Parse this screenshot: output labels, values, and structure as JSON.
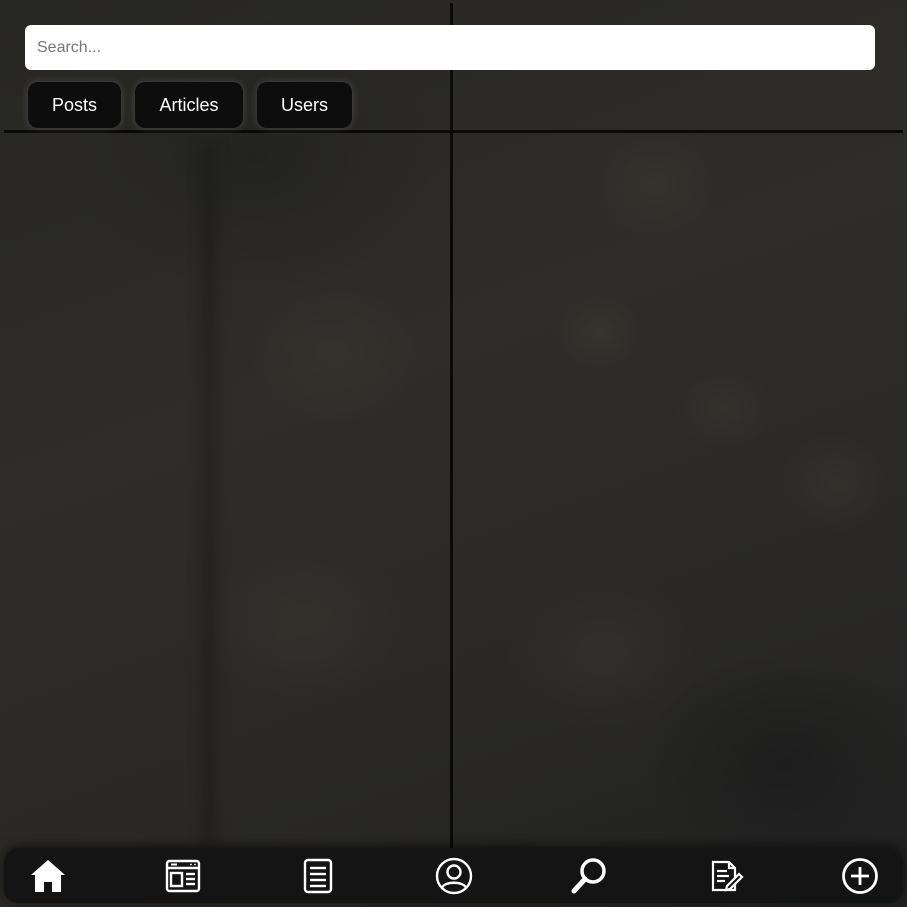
{
  "search": {
    "placeholder": "Search..."
  },
  "tabs": [
    {
      "label": "Posts"
    },
    {
      "label": "Articles"
    },
    {
      "label": "Users"
    }
  ],
  "navbar": {
    "items": [
      {
        "icon": "home-icon"
      },
      {
        "icon": "dashboard-icon"
      },
      {
        "icon": "list-icon"
      },
      {
        "icon": "user-icon"
      },
      {
        "icon": "search-icon"
      },
      {
        "icon": "edit-document-icon"
      },
      {
        "icon": "add-circle-icon"
      }
    ]
  },
  "colors": {
    "tab_background": "#0d0d0d",
    "navbar_background": "#141414",
    "icon_color": "#ffffff",
    "search_background": "#ffffff"
  }
}
